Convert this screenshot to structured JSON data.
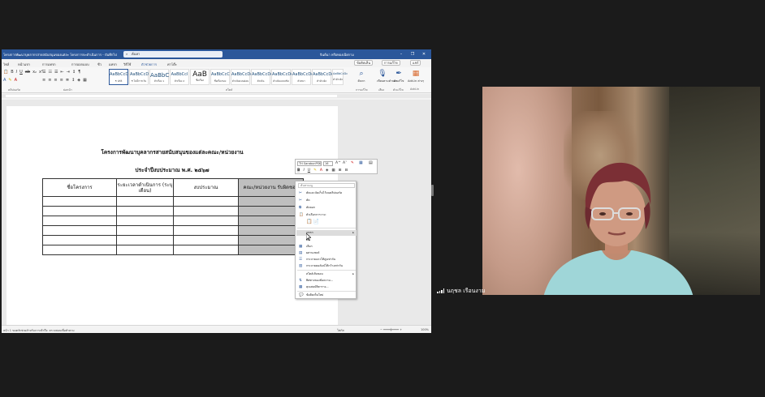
{
  "word": {
    "title_bar": {
      "doc_title": "โครงการพัฒนาบุคลากรสายสนับสนุนของแต่ละ  โครงการจะดำเนินการ - บันทึกไปยัง พีซีนี้",
      "search_placeholder": "ค้นหา",
      "search_icon": "search-icon",
      "user": "จินต์นา หรือทองเนียกาม",
      "minimize": "–",
      "restore": "❐",
      "close": "✕"
    },
    "menu_tabs": [
      {
        "label": "ไฟล์"
      },
      {
        "label": "หน้าแรก"
      },
      {
        "label": "การแทรก"
      },
      {
        "label": "การออกแบบ"
      },
      {
        "label": "ชีว"
      },
      {
        "label": "แทรก"
      },
      {
        "label": "วิธีใช้"
      },
      {
        "label": "ตัวช่วยการ"
      },
      {
        "label": "ค่าโต๊ะ"
      }
    ],
    "menu_buttons": {
      "comments": "ข้อคิดเห็น",
      "editing": "การแก้ไข",
      "share": "แชร์"
    },
    "styles": [
      {
        "sample": "AaBbCcD",
        "name": "¶ ปกติ"
      },
      {
        "sample": "AaBbCcD",
        "name": "¶ ไม่มีการเว้น"
      },
      {
        "sample": "AaBbC",
        "name": "หัวเรื่อง 1"
      },
      {
        "sample": "AaBbCcI",
        "name": "หัวเรื่อง 2"
      },
      {
        "sample": "AaB",
        "name": "ชื่อเรื่อง"
      },
      {
        "sample": "AaBbCcC",
        "name": "ชื่อเรื่องรอง"
      },
      {
        "sample": "AaBbCcDc",
        "name": "ตัวเน้นแบบอ่อน"
      },
      {
        "sample": "AaBbCcDc",
        "name": "ตัวเน้น"
      },
      {
        "sample": "AaBbCcDc",
        "name": "ตัวเน้นแบบเข้ม"
      },
      {
        "sample": "AaBbCcDc",
        "name": "ตัวหนา"
      },
      {
        "sample": "AaBbCcDc",
        "name": "คำอ้างอิง"
      },
      {
        "sample": "AaBbCcDc",
        "name": "คำอ้างอิงเข้ม"
      }
    ],
    "ribbon_groups": {
      "clipboard": "คลิปบอร์ด",
      "font": "ฟอนต์",
      "paragraph": "ย่อหน้า",
      "styles": "สไตล์",
      "editing": "การแก้ไข",
      "voice": "เสียง",
      "sensitivity": "ตัวแก้ไข",
      "addins": "Add-in"
    },
    "ribbon_right": [
      {
        "icon": "find-icon",
        "label": "ค้นหา"
      },
      {
        "icon": "microphone-icon",
        "label": "เขียนตามคำบอก"
      },
      {
        "icon": "editor-icon",
        "label": "ตัวแก้ไข"
      },
      {
        "icon": "addin-icon",
        "label": "Add-in ต่างๆ"
      }
    ],
    "document": {
      "heading1": "โครงการพัฒนาบุคลากรสายสนับสนุนของแต่ละคณะ/หน่วยงาน",
      "heading2": "ประจำปีงบประมาณ พ.ศ. ๒๕๖๗",
      "table_headers": [
        "ชื่อโครงการ",
        "ระยะเวลาดำเนินการ (ระบุเดือน)",
        "งบประมาณ",
        "คณะ/หน่วยงาน รับผิดชอบ"
      ]
    },
    "status_bar": {
      "page": "หน้า 1 ของ 1",
      "accessibility": "การช่วยสำหรับการเข้าถึง: ตรวจสอบเพื่อทำตาม",
      "focus": "โฟกัส",
      "zoom": "100%"
    },
    "mini_toolbar": {
      "font": "TH SarabunPSK",
      "size": "16",
      "bold": "B",
      "italic": "I",
      "underline": "U"
    },
    "context_menu": {
      "search_placeholder": "ค้นหาเมนู",
      "items": [
        {
          "icon": "cut-icon",
          "label": "ตัดและจัดเก็บไว้บนคลิปบอร์ด"
        },
        {
          "icon": "copy-icon",
          "label": "ตัด"
        },
        {
          "icon": "copy-icon",
          "label": "คัดลอก"
        },
        {
          "icon": "paste-icon",
          "label": "ตัวเลือกการวาง:"
        },
        {
          "icon": "insert-icon",
          "label": "แทรก",
          "submenu": true,
          "highlight": true
        },
        {
          "icon": "delete-icon",
          "label": "ลบ"
        },
        {
          "icon": "select-icon",
          "label": "เลือก"
        },
        {
          "icon": "merge-icon",
          "label": "ผสานเซลล์"
        },
        {
          "icon": "row-icon",
          "label": "กระจายแถวให้สูงเท่ากัน"
        },
        {
          "icon": "col-icon",
          "label": "กระจายคอลัมน์ให้กว้างเท่ากัน"
        },
        {
          "icon": "border-icon",
          "label": "สไตล์เส้นขอบ"
        },
        {
          "icon": "direction-icon",
          "label": "ทิศทางของข้อความ..."
        },
        {
          "icon": "props-icon",
          "label": "คุณสมบัติตาราง..."
        },
        {
          "icon": "comment-icon",
          "label": "ข้อคิดเห็นใหม่"
        }
      ]
    }
  },
  "participant": {
    "name": "นฤชล  เรือนงาม",
    "signal_icon": "signal-bars-icon"
  }
}
